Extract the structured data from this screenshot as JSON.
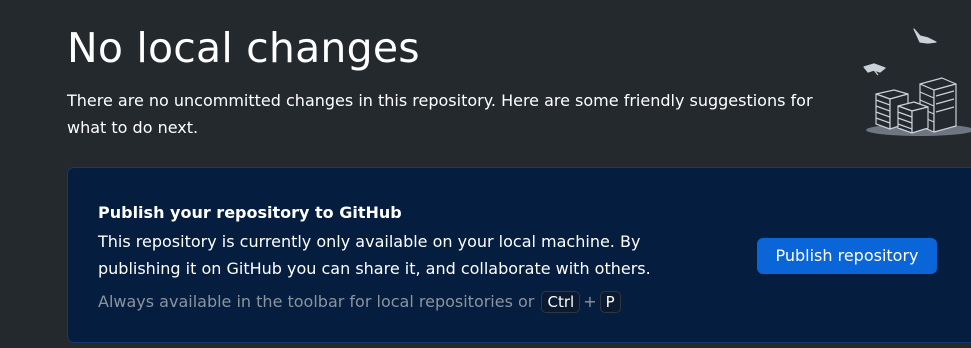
{
  "header": {
    "title": "No local changes",
    "subtitle": "There are no uncommitted changes in this repository. Here are some friendly suggestions for what to do next."
  },
  "publish_card": {
    "title": "Publish your repository to GitHub",
    "description": "This repository is currently only available on your local machine. By publishing it on GitHub you can share it, and collaborate with others.",
    "hint_text": "Always available in the toolbar for local repositories or",
    "shortcut_key_1": "Ctrl",
    "shortcut_plus": "+",
    "shortcut_key_2": "P",
    "button_label": "Publish repository"
  },
  "colors": {
    "background": "#24292e",
    "card_background": "#051d3e",
    "card_border": "#163b6b",
    "button_background": "#0a65d8",
    "hint_text": "#8b949e"
  },
  "icons": {
    "illustration": "paper-stacks-illustration-icon"
  }
}
